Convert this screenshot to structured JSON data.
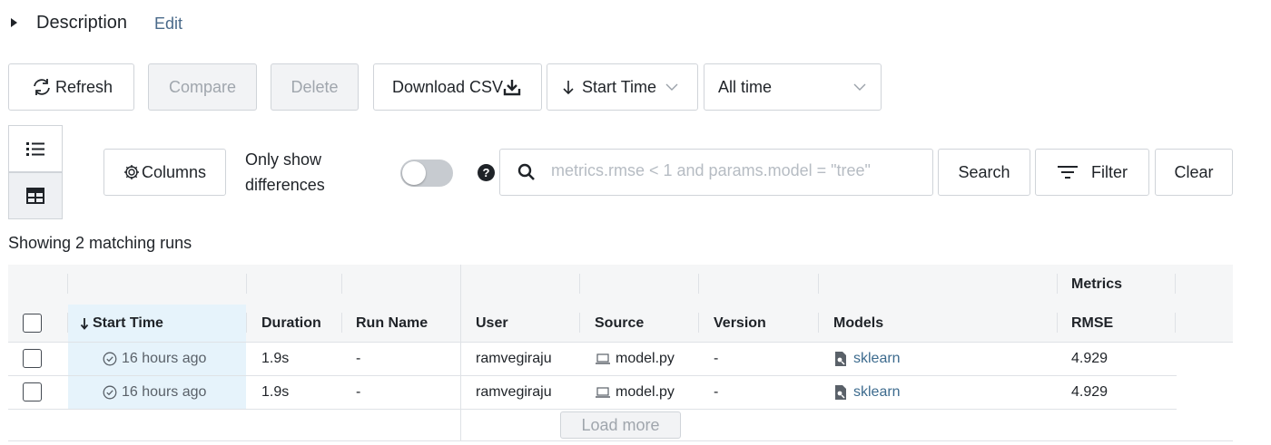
{
  "description": {
    "title": "Description",
    "edit_label": "Edit"
  },
  "toolbar": {
    "refresh_label": "Refresh",
    "compare_label": "Compare",
    "delete_label": "Delete",
    "download_label": "Download CSV",
    "sort_label": "Start Time",
    "time_range_label": "All time"
  },
  "filters": {
    "columns_label": "Columns",
    "only_diff_line1": "Only show",
    "only_diff_line2": "differences",
    "only_diff_on": false,
    "help_glyph": "?",
    "search_placeholder": "metrics.rmse < 1 and params.model = \"tree\"",
    "search_value": "",
    "search_button": "Search",
    "filter_button": "Filter",
    "clear_button": "Clear"
  },
  "summary": "Showing 2 matching runs",
  "table": {
    "group_header_metrics": "Metrics",
    "columns": {
      "start_time": "Start Time",
      "duration": "Duration",
      "run_name": "Run Name",
      "user": "User",
      "source": "Source",
      "version": "Version",
      "models": "Models",
      "rmse": "RMSE"
    },
    "rows": [
      {
        "start_time": "16 hours ago",
        "duration": "1.9s",
        "run_name": "-",
        "user": "ramvegiraju",
        "source": "model.py",
        "version": "-",
        "model": "sklearn",
        "rmse": "4.929"
      },
      {
        "start_time": "16 hours ago",
        "duration": "1.9s",
        "run_name": "-",
        "user": "ramvegiraju",
        "source": "model.py",
        "version": "-",
        "model": "sklearn",
        "rmse": "4.929"
      }
    ],
    "load_more_label": "Load more"
  },
  "icons": {
    "expand": "caret-right-icon",
    "refresh": "refresh-icon",
    "download": "download-icon",
    "sort": "arrow-down-icon",
    "dropdown": "chevron-down-icon",
    "list_view": "list-view-icon",
    "table_view": "table-view-icon",
    "columns": "gear-icon",
    "help": "question-circle-icon",
    "search": "search-icon",
    "filter": "filter-icon",
    "status": "check-circle-icon",
    "source": "laptop-icon",
    "model": "model-icon"
  },
  "colors": {
    "link": "#3d6b8e",
    "highlight": "#e6f3fb",
    "header_bg": "#f5f6f7"
  }
}
